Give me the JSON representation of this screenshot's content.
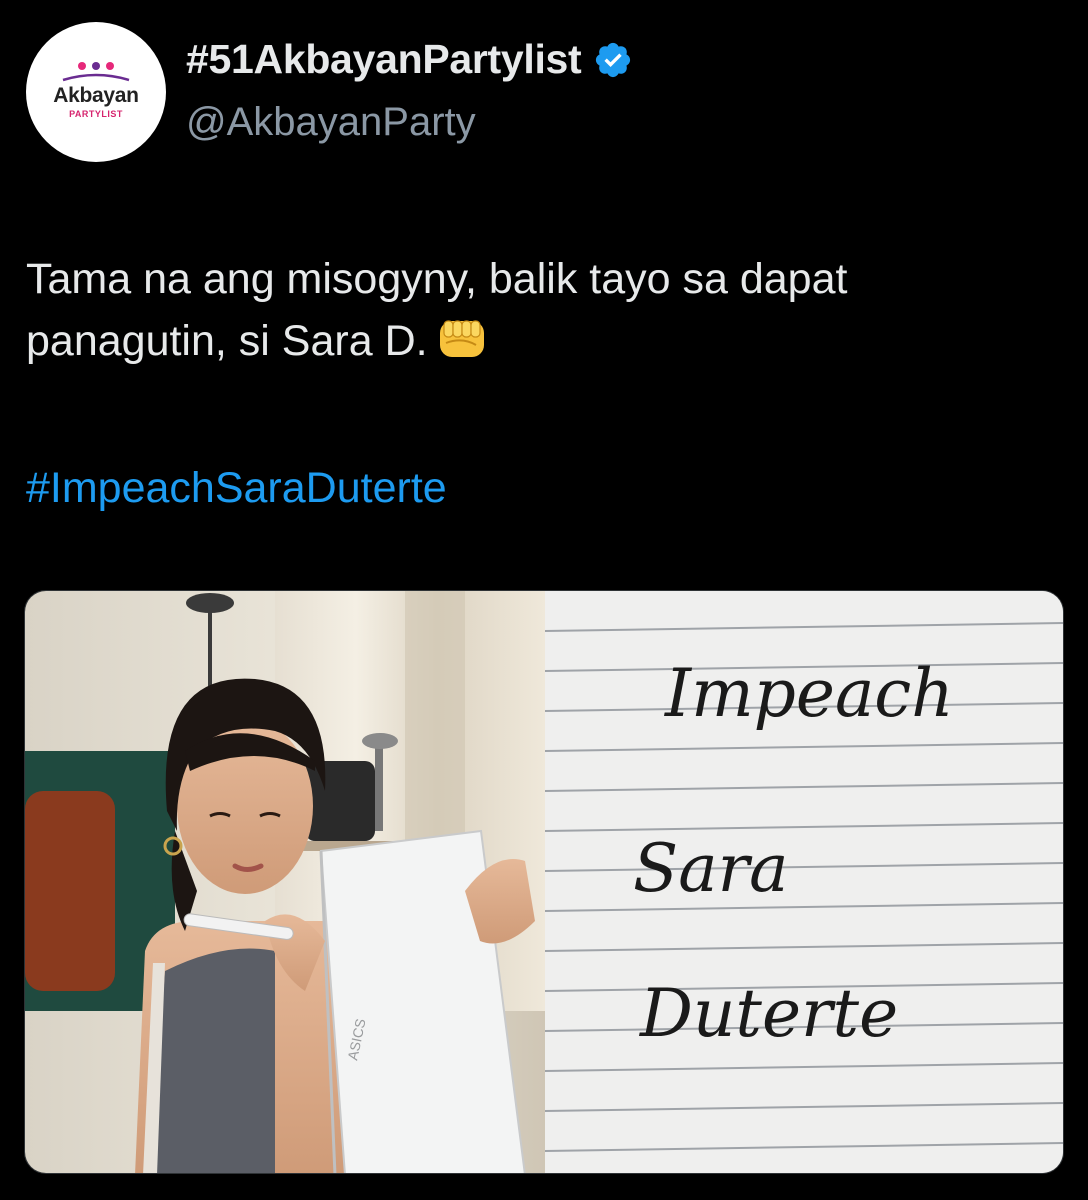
{
  "account": {
    "display_name": "#51AkbayanPartylist",
    "handle": "@AkbayanParty",
    "verified_color": "#1d9bf0",
    "avatar": {
      "brand_text": "Akbayan",
      "sub_text": "PARTYLIST",
      "dot_colors": [
        "#e6287a",
        "#6a2c91",
        "#e6287a"
      ]
    }
  },
  "tweet": {
    "line1": "Tama na ang misogyny, balik tayo sa dapat",
    "line2": "panagutin, si Sara D.",
    "emoji": "fist-icon",
    "hashtag": "#ImpeachSaraDuterte"
  },
  "media": {
    "left_photo": "woman-writing-on-notepad",
    "notepad_brand": "ASICS",
    "handwriting": [
      "Impeach",
      "Sara",
      "Duterte"
    ]
  }
}
